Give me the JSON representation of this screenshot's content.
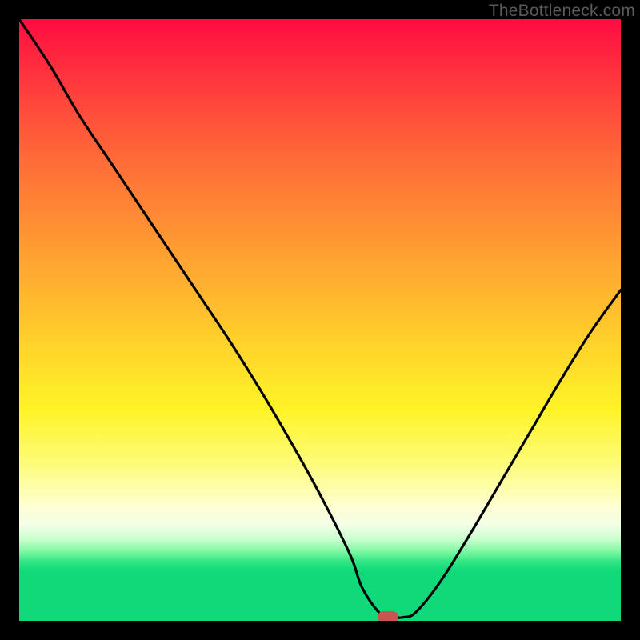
{
  "watermark": "TheBottleneck.com",
  "marker": {
    "x_frac": 0.613,
    "y_frac": 0.994
  },
  "chart_data": {
    "type": "line",
    "title": "",
    "xlabel": "",
    "ylabel": "",
    "xlim": [
      0,
      100
    ],
    "ylim": [
      0,
      100
    ],
    "series": [
      {
        "name": "curve",
        "x": [
          0,
          5,
          10,
          15,
          20,
          25,
          30,
          35,
          40,
          45,
          50,
          55,
          57,
          60,
          62,
          64,
          66,
          70,
          75,
          80,
          85,
          90,
          95,
          100
        ],
        "y": [
          100,
          92.5,
          84,
          76.5,
          69,
          61.5,
          54,
          46.5,
          38.5,
          30,
          21,
          11,
          5.5,
          1.2,
          0.6,
          0.6,
          1.5,
          6.5,
          14.5,
          23,
          31.5,
          40,
          48,
          55
        ]
      }
    ],
    "gradient_stops": [
      {
        "pos": 0.0,
        "color": "#ff0b42"
      },
      {
        "pos": 0.16,
        "color": "#ff4f3b"
      },
      {
        "pos": 0.35,
        "color": "#ff9233"
      },
      {
        "pos": 0.55,
        "color": "#ffd62b"
      },
      {
        "pos": 0.74,
        "color": "#fdfc7a"
      },
      {
        "pos": 0.84,
        "color": "#f3ffe6"
      },
      {
        "pos": 0.9,
        "color": "#38e786"
      },
      {
        "pos": 1.0,
        "color": "#10d97a"
      }
    ],
    "marker": {
      "x": 61.3,
      "y": 0.6,
      "color": "#c9554e"
    }
  }
}
